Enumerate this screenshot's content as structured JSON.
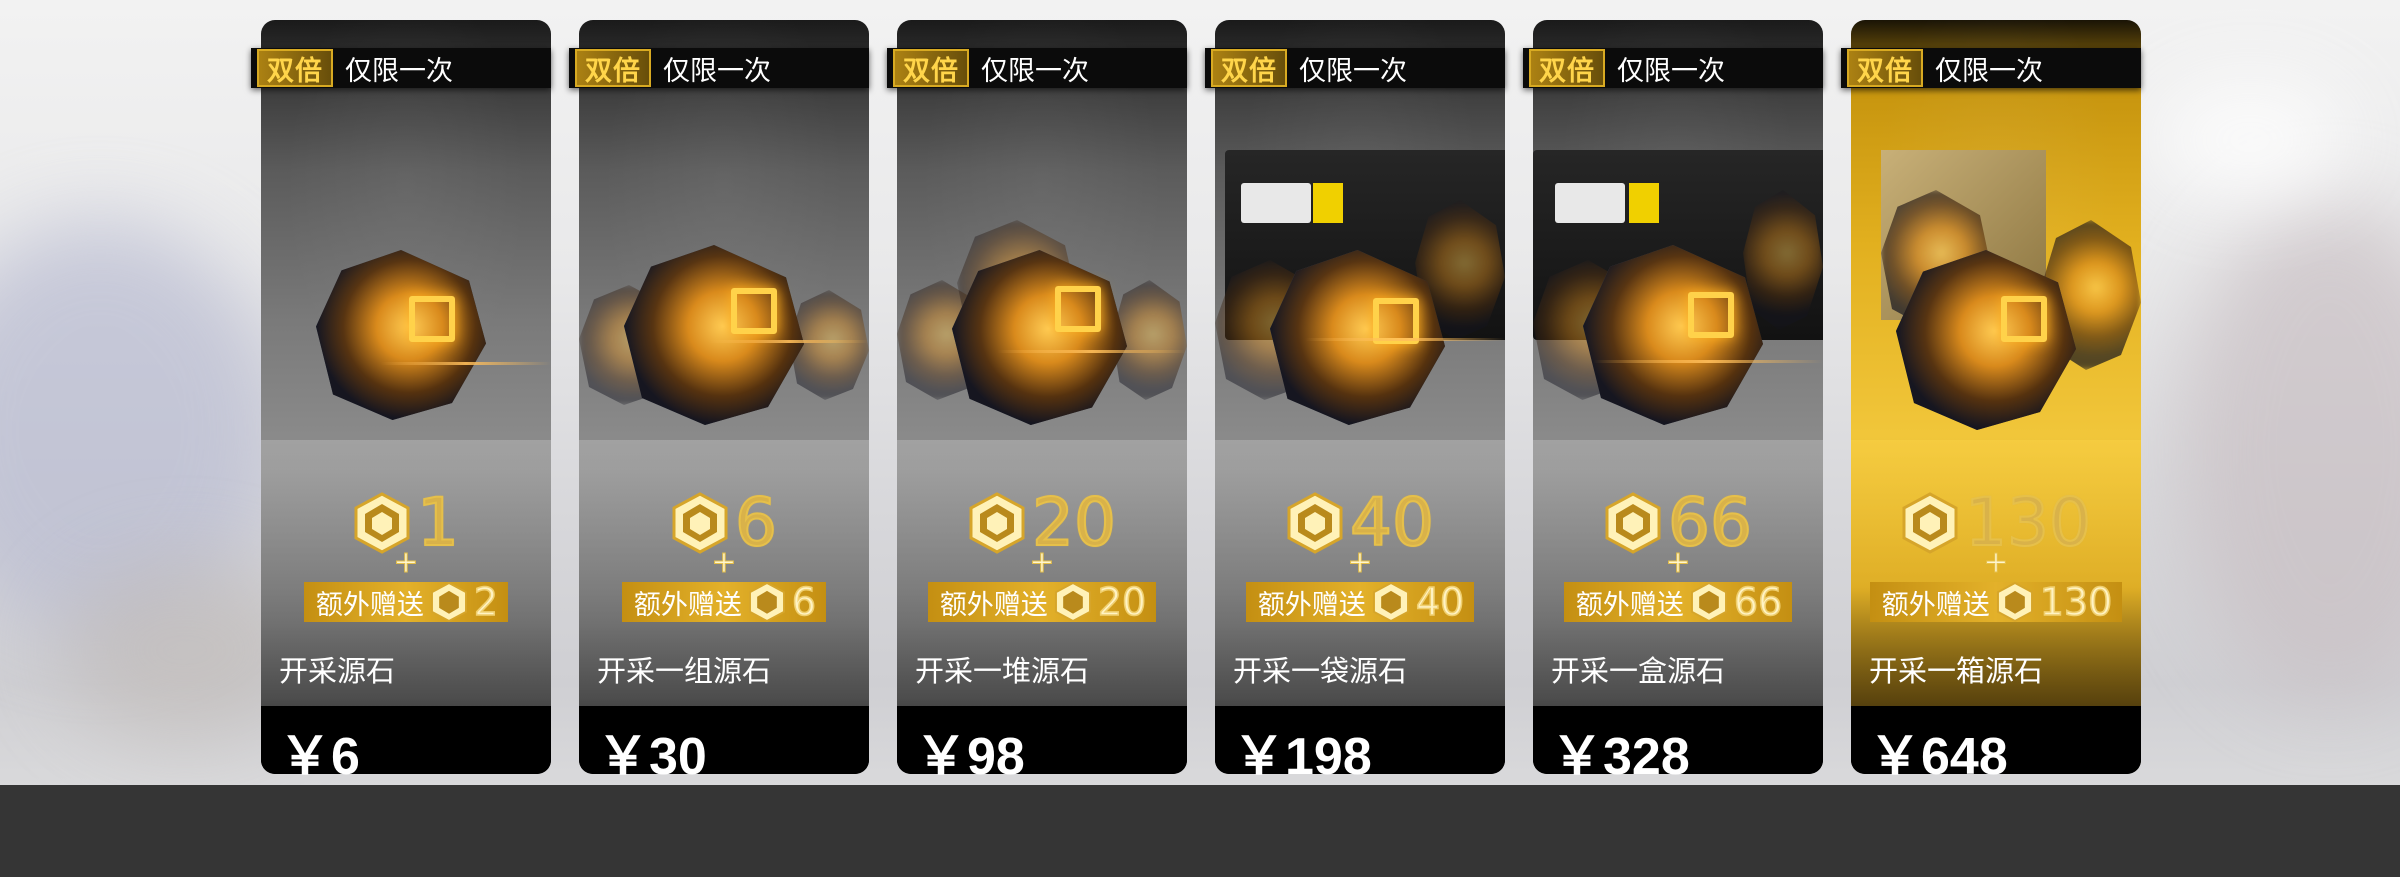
{
  "promo": {
    "double_label": "双倍",
    "limit_label": "仅限一次",
    "bonus_label": "额外赠送"
  },
  "currency_icon": "originium-hex-icon",
  "accent_color": "#e3b12a",
  "packs": [
    {
      "amount": "1",
      "plus": "+",
      "bonus": "2",
      "name": "开采源石",
      "price": "￥6"
    },
    {
      "amount": "6",
      "plus": "+",
      "bonus": "6",
      "name": "开采一组源石",
      "price": "￥30"
    },
    {
      "amount": "20",
      "plus": "+",
      "bonus": "20",
      "name": "开采一堆源石",
      "price": "￥98"
    },
    {
      "amount": "40",
      "plus": "+",
      "bonus": "40",
      "name": "开采一袋源石",
      "price": "￥198"
    },
    {
      "amount": "66",
      "plus": "+",
      "bonus": "66",
      "name": "开采一盒源石",
      "price": "￥328"
    },
    {
      "amount": "130",
      "plus": "+",
      "bonus": "130",
      "name": "开采一箱源石",
      "price": "￥648"
    }
  ]
}
